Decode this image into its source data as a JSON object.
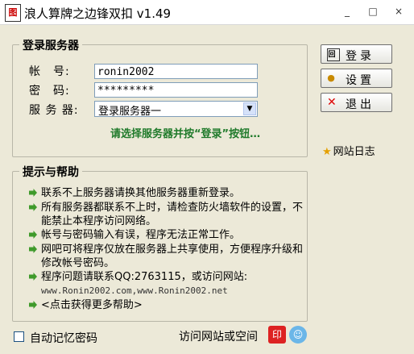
{
  "window": {
    "title": "浪人算牌之边锋双扣 v1.49",
    "app_icon_text": "图",
    "controls": [
      "_",
      "□",
      "×"
    ]
  },
  "login_group": {
    "title": "登录服务器",
    "account_label": "帐　号:",
    "account_value": "ronin2002",
    "password_label": "密　码:",
    "password_value": "*********",
    "server_label": "服 务 器:",
    "server_selected": "登录服务器一",
    "hint": "请选择服务器并按“登录”按钮…"
  },
  "buttons": {
    "login": "登录",
    "settings": "设置",
    "exit": "退出"
  },
  "site_log": "网站日志",
  "help_group": {
    "title": "提示与帮助",
    "items": [
      "联系不上服务器请换其他服务器重新登录。",
      "所有服务器都联系不上时，请检查防火墙软件的设置，不能禁止本程序访问网络。",
      "帐号与密码输入有误，程序无法正常工作。",
      "网吧可将程序仅放在服务器上共享使用，方便程序升级和修改帐号密码。",
      "程序问题请联系QQ:2763115，或访问网站:",
      "<点击获得更多帮助>"
    ],
    "website": "www.Ronin2002.com,www.Ronin2002.net"
  },
  "footer": {
    "remember_password": "自动记忆密码",
    "visit_link": "访问网站或空间"
  },
  "colors": {
    "background": "#ece9d8",
    "hint_green": "#1f7a2a",
    "arrow_green": "#3f9a2b"
  }
}
